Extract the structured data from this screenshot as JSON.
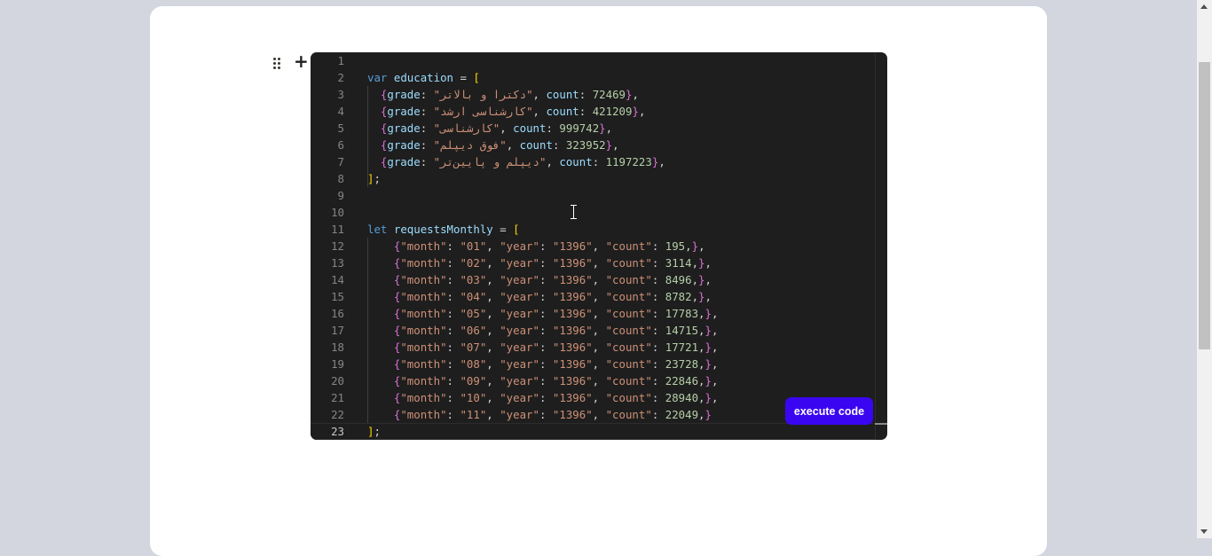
{
  "editor": {
    "lines": [
      {
        "n": "1",
        "tokens": []
      },
      {
        "n": "2",
        "tokens": [
          [
            "kw",
            "var"
          ],
          [
            "plain",
            " "
          ],
          [
            "var",
            "education"
          ],
          [
            "plain",
            " = "
          ],
          [
            "br1",
            "["
          ]
        ]
      },
      {
        "n": "3",
        "tokens": [
          [
            "plain",
            "  "
          ],
          [
            "br2",
            "{"
          ],
          [
            "var",
            "grade"
          ],
          [
            "plain",
            ": "
          ],
          [
            "str",
            "\"دکترا و بالاتر\""
          ],
          [
            "plain",
            ", "
          ],
          [
            "var",
            "count"
          ],
          [
            "plain",
            ": "
          ],
          [
            "num",
            "72469"
          ],
          [
            "br2",
            "}"
          ],
          [
            "plain",
            ","
          ]
        ]
      },
      {
        "n": "4",
        "tokens": [
          [
            "plain",
            "  "
          ],
          [
            "br2",
            "{"
          ],
          [
            "var",
            "grade"
          ],
          [
            "plain",
            ": "
          ],
          [
            "str",
            "\"کارشناسی ارشد\""
          ],
          [
            "plain",
            ", "
          ],
          [
            "var",
            "count"
          ],
          [
            "plain",
            ": "
          ],
          [
            "num",
            "421209"
          ],
          [
            "br2",
            "}"
          ],
          [
            "plain",
            ","
          ]
        ]
      },
      {
        "n": "5",
        "tokens": [
          [
            "plain",
            "  "
          ],
          [
            "br2",
            "{"
          ],
          [
            "var",
            "grade"
          ],
          [
            "plain",
            ": "
          ],
          [
            "str",
            "\"کارشناسی\""
          ],
          [
            "plain",
            ", "
          ],
          [
            "var",
            "count"
          ],
          [
            "plain",
            ": "
          ],
          [
            "num",
            "999742"
          ],
          [
            "br2",
            "}"
          ],
          [
            "plain",
            ","
          ]
        ]
      },
      {
        "n": "6",
        "tokens": [
          [
            "plain",
            "  "
          ],
          [
            "br2",
            "{"
          ],
          [
            "var",
            "grade"
          ],
          [
            "plain",
            ": "
          ],
          [
            "str",
            "\"فوق دیپلم\""
          ],
          [
            "plain",
            ", "
          ],
          [
            "var",
            "count"
          ],
          [
            "plain",
            ": "
          ],
          [
            "num",
            "323952"
          ],
          [
            "br2",
            "}"
          ],
          [
            "plain",
            ","
          ]
        ]
      },
      {
        "n": "7",
        "tokens": [
          [
            "plain",
            "  "
          ],
          [
            "br2",
            "{"
          ],
          [
            "var",
            "grade"
          ],
          [
            "plain",
            ": "
          ],
          [
            "str",
            "\"دیپلم و پایین‌تر\""
          ],
          [
            "plain",
            ", "
          ],
          [
            "var",
            "count"
          ],
          [
            "plain",
            ": "
          ],
          [
            "num",
            "1197223"
          ],
          [
            "br2",
            "}"
          ],
          [
            "plain",
            ","
          ]
        ]
      },
      {
        "n": "8",
        "tokens": [
          [
            "br1",
            "]"
          ],
          [
            "plain",
            ";"
          ]
        ]
      },
      {
        "n": "9",
        "tokens": []
      },
      {
        "n": "10",
        "tokens": []
      },
      {
        "n": "11",
        "tokens": [
          [
            "kw",
            "let"
          ],
          [
            "plain",
            " "
          ],
          [
            "var",
            "requestsMonthly"
          ],
          [
            "plain",
            " = "
          ],
          [
            "br1",
            "["
          ]
        ]
      },
      {
        "n": "12",
        "tokens": [
          [
            "plain",
            "    "
          ],
          [
            "br2",
            "{"
          ],
          [
            "str",
            "\"month\""
          ],
          [
            "plain",
            ": "
          ],
          [
            "str",
            "\"01\""
          ],
          [
            "plain",
            ", "
          ],
          [
            "str",
            "\"year\""
          ],
          [
            "plain",
            ": "
          ],
          [
            "str",
            "\"1396\""
          ],
          [
            "plain",
            ", "
          ],
          [
            "str",
            "\"count\""
          ],
          [
            "plain",
            ": "
          ],
          [
            "num",
            "195"
          ],
          [
            "plain",
            ","
          ],
          [
            "br2",
            "}"
          ],
          [
            "plain",
            ","
          ]
        ]
      },
      {
        "n": "13",
        "tokens": [
          [
            "plain",
            "    "
          ],
          [
            "br2",
            "{"
          ],
          [
            "str",
            "\"month\""
          ],
          [
            "plain",
            ": "
          ],
          [
            "str",
            "\"02\""
          ],
          [
            "plain",
            ", "
          ],
          [
            "str",
            "\"year\""
          ],
          [
            "plain",
            ": "
          ],
          [
            "str",
            "\"1396\""
          ],
          [
            "plain",
            ", "
          ],
          [
            "str",
            "\"count\""
          ],
          [
            "plain",
            ": "
          ],
          [
            "num",
            "3114"
          ],
          [
            "plain",
            ","
          ],
          [
            "br2",
            "}"
          ],
          [
            "plain",
            ","
          ]
        ]
      },
      {
        "n": "14",
        "tokens": [
          [
            "plain",
            "    "
          ],
          [
            "br2",
            "{"
          ],
          [
            "str",
            "\"month\""
          ],
          [
            "plain",
            ": "
          ],
          [
            "str",
            "\"03\""
          ],
          [
            "plain",
            ", "
          ],
          [
            "str",
            "\"year\""
          ],
          [
            "plain",
            ": "
          ],
          [
            "str",
            "\"1396\""
          ],
          [
            "plain",
            ", "
          ],
          [
            "str",
            "\"count\""
          ],
          [
            "plain",
            ": "
          ],
          [
            "num",
            "8496"
          ],
          [
            "plain",
            ","
          ],
          [
            "br2",
            "}"
          ],
          [
            "plain",
            ","
          ]
        ]
      },
      {
        "n": "15",
        "tokens": [
          [
            "plain",
            "    "
          ],
          [
            "br2",
            "{"
          ],
          [
            "str",
            "\"month\""
          ],
          [
            "plain",
            ": "
          ],
          [
            "str",
            "\"04\""
          ],
          [
            "plain",
            ", "
          ],
          [
            "str",
            "\"year\""
          ],
          [
            "plain",
            ": "
          ],
          [
            "str",
            "\"1396\""
          ],
          [
            "plain",
            ", "
          ],
          [
            "str",
            "\"count\""
          ],
          [
            "plain",
            ": "
          ],
          [
            "num",
            "8782"
          ],
          [
            "plain",
            ","
          ],
          [
            "br2",
            "}"
          ],
          [
            "plain",
            ","
          ]
        ]
      },
      {
        "n": "16",
        "tokens": [
          [
            "plain",
            "    "
          ],
          [
            "br2",
            "{"
          ],
          [
            "str",
            "\"month\""
          ],
          [
            "plain",
            ": "
          ],
          [
            "str",
            "\"05\""
          ],
          [
            "plain",
            ", "
          ],
          [
            "str",
            "\"year\""
          ],
          [
            "plain",
            ": "
          ],
          [
            "str",
            "\"1396\""
          ],
          [
            "plain",
            ", "
          ],
          [
            "str",
            "\"count\""
          ],
          [
            "plain",
            ": "
          ],
          [
            "num",
            "17783"
          ],
          [
            "plain",
            ","
          ],
          [
            "br2",
            "}"
          ],
          [
            "plain",
            ","
          ]
        ]
      },
      {
        "n": "17",
        "tokens": [
          [
            "plain",
            "    "
          ],
          [
            "br2",
            "{"
          ],
          [
            "str",
            "\"month\""
          ],
          [
            "plain",
            ": "
          ],
          [
            "str",
            "\"06\""
          ],
          [
            "plain",
            ", "
          ],
          [
            "str",
            "\"year\""
          ],
          [
            "plain",
            ": "
          ],
          [
            "str",
            "\"1396\""
          ],
          [
            "plain",
            ", "
          ],
          [
            "str",
            "\"count\""
          ],
          [
            "plain",
            ": "
          ],
          [
            "num",
            "14715"
          ],
          [
            "plain",
            ","
          ],
          [
            "br2",
            "}"
          ],
          [
            "plain",
            ","
          ]
        ]
      },
      {
        "n": "18",
        "tokens": [
          [
            "plain",
            "    "
          ],
          [
            "br2",
            "{"
          ],
          [
            "str",
            "\"month\""
          ],
          [
            "plain",
            ": "
          ],
          [
            "str",
            "\"07\""
          ],
          [
            "plain",
            ", "
          ],
          [
            "str",
            "\"year\""
          ],
          [
            "plain",
            ": "
          ],
          [
            "str",
            "\"1396\""
          ],
          [
            "plain",
            ", "
          ],
          [
            "str",
            "\"count\""
          ],
          [
            "plain",
            ": "
          ],
          [
            "num",
            "17721"
          ],
          [
            "plain",
            ","
          ],
          [
            "br2",
            "}"
          ],
          [
            "plain",
            ","
          ]
        ]
      },
      {
        "n": "19",
        "tokens": [
          [
            "plain",
            "    "
          ],
          [
            "br2",
            "{"
          ],
          [
            "str",
            "\"month\""
          ],
          [
            "plain",
            ": "
          ],
          [
            "str",
            "\"08\""
          ],
          [
            "plain",
            ", "
          ],
          [
            "str",
            "\"year\""
          ],
          [
            "plain",
            ": "
          ],
          [
            "str",
            "\"1396\""
          ],
          [
            "plain",
            ", "
          ],
          [
            "str",
            "\"count\""
          ],
          [
            "plain",
            ": "
          ],
          [
            "num",
            "23728"
          ],
          [
            "plain",
            ","
          ],
          [
            "br2",
            "}"
          ],
          [
            "plain",
            ","
          ]
        ]
      },
      {
        "n": "20",
        "tokens": [
          [
            "plain",
            "    "
          ],
          [
            "br2",
            "{"
          ],
          [
            "str",
            "\"month\""
          ],
          [
            "plain",
            ": "
          ],
          [
            "str",
            "\"09\""
          ],
          [
            "plain",
            ", "
          ],
          [
            "str",
            "\"year\""
          ],
          [
            "plain",
            ": "
          ],
          [
            "str",
            "\"1396\""
          ],
          [
            "plain",
            ", "
          ],
          [
            "str",
            "\"count\""
          ],
          [
            "plain",
            ": "
          ],
          [
            "num",
            "22846"
          ],
          [
            "plain",
            ","
          ],
          [
            "br2",
            "}"
          ],
          [
            "plain",
            ","
          ]
        ]
      },
      {
        "n": "21",
        "tokens": [
          [
            "plain",
            "    "
          ],
          [
            "br2",
            "{"
          ],
          [
            "str",
            "\"month\""
          ],
          [
            "plain",
            ": "
          ],
          [
            "str",
            "\"10\""
          ],
          [
            "plain",
            ", "
          ],
          [
            "str",
            "\"year\""
          ],
          [
            "plain",
            ": "
          ],
          [
            "str",
            "\"1396\""
          ],
          [
            "plain",
            ", "
          ],
          [
            "str",
            "\"count\""
          ],
          [
            "plain",
            ": "
          ],
          [
            "num",
            "28940"
          ],
          [
            "plain",
            ","
          ],
          [
            "br2",
            "}"
          ],
          [
            "plain",
            ","
          ]
        ]
      },
      {
        "n": "22",
        "tokens": [
          [
            "plain",
            "    "
          ],
          [
            "br2",
            "{"
          ],
          [
            "str",
            "\"month\""
          ],
          [
            "plain",
            ": "
          ],
          [
            "str",
            "\"11\""
          ],
          [
            "plain",
            ", "
          ],
          [
            "str",
            "\"year\""
          ],
          [
            "plain",
            ": "
          ],
          [
            "str",
            "\"1396\""
          ],
          [
            "plain",
            ", "
          ],
          [
            "str",
            "\"count\""
          ],
          [
            "plain",
            ": "
          ],
          [
            "num",
            "22049"
          ],
          [
            "plain",
            ","
          ],
          [
            "br2",
            "}"
          ]
        ]
      },
      {
        "n": "23",
        "tokens": [
          [
            "br1",
            "]"
          ],
          [
            "plain",
            ";"
          ]
        ]
      }
    ],
    "current_line": "23",
    "theme_colors": {
      "background": "#1e1e1e",
      "keyword": "#569cd6",
      "string": "#ce9178",
      "number": "#b5cea8"
    }
  },
  "block_controls": {
    "drag_icon": "drag-handle-icon",
    "add_icon": "plus-icon",
    "add_label": "+"
  },
  "run_button": {
    "label": "execute code",
    "color": "#3a06f2"
  }
}
